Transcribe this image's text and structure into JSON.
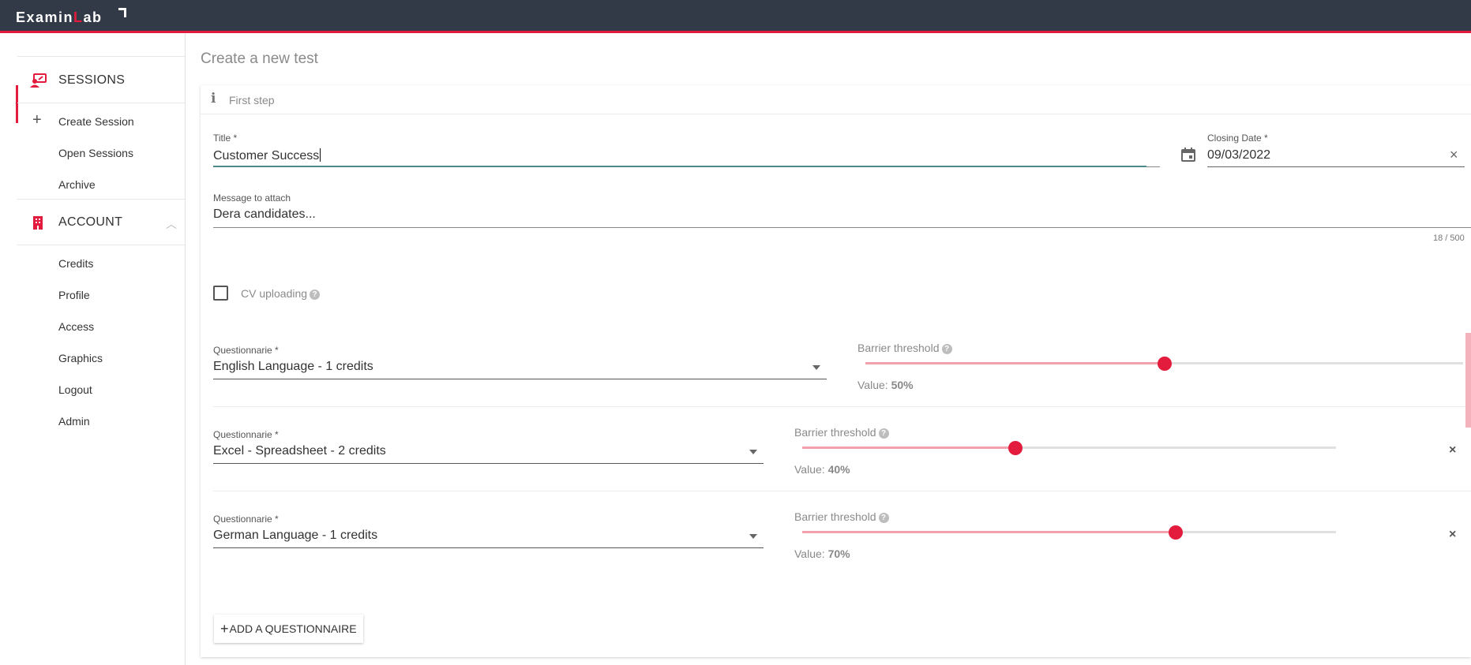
{
  "app": {
    "logo_prefix": "Examin",
    "logo_accent": "L",
    "logo_suffix": "ab",
    "brand_color": "#e31c3d",
    "topbar_color": "#323a47"
  },
  "sidebar": {
    "sessions": {
      "label": "SESSIONS",
      "icon": "presentation-user-icon",
      "items": [
        {
          "label": "Create Session",
          "icon": "plus-icon"
        },
        {
          "label": "Open Sessions"
        },
        {
          "label": "Archive"
        }
      ]
    },
    "account": {
      "label": "ACCOUNT",
      "icon": "building-icon",
      "expanded": true,
      "items": [
        {
          "label": "Credits"
        },
        {
          "label": "Profile"
        },
        {
          "label": "Access"
        },
        {
          "label": "Graphics"
        },
        {
          "label": "Logout"
        },
        {
          "label": "Admin"
        }
      ]
    }
  },
  "main": {
    "page_title": "Create a new test",
    "step": {
      "label": "First step",
      "icon": "info-icon"
    },
    "form": {
      "title": {
        "label": "Title *",
        "value": "Customer Success"
      },
      "closing_date": {
        "label": "Closing Date *",
        "value": "09/03/2022",
        "icon": "calendar-icon"
      },
      "message": {
        "label": "Message to attach",
        "value": "Dera candidates...",
        "counter": "18 / 500"
      },
      "cv_uploading": {
        "label": "CV uploading",
        "checked": false,
        "help_icon": "?"
      },
      "questionnaires": [
        {
          "label": "Questionnarie *",
          "value": "English Language - 1 credits",
          "barrier_label": "Barrier threshold",
          "value_prefix": "Value:",
          "threshold": "50%",
          "threshold_fraction": 0.5,
          "removable": false
        },
        {
          "label": "Questionnarie *",
          "value": "Excel - Spreadsheet - 2 credits",
          "barrier_label": "Barrier threshold",
          "value_prefix": "Value:",
          "threshold": "40%",
          "threshold_fraction": 0.4,
          "removable": true
        },
        {
          "label": "Questionnarie *",
          "value": "German Language - 1 credits",
          "barrier_label": "Barrier threshold",
          "value_prefix": "Value:",
          "threshold": "70%",
          "threshold_fraction": 0.7,
          "removable": true
        }
      ],
      "add_button": {
        "label": "ADD A QUESTIONNAIRE"
      },
      "clear_icon": "×",
      "remove_icon": "×",
      "plus_icon": "+"
    }
  }
}
